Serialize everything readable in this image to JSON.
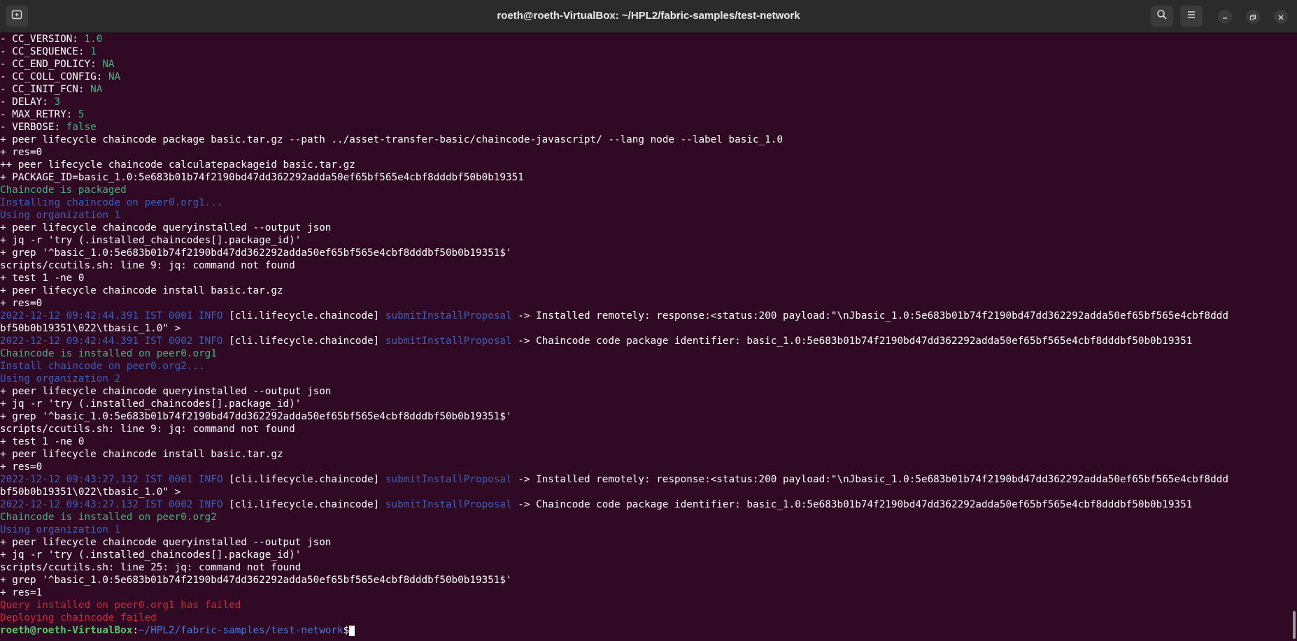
{
  "window": {
    "title": "roeth@roeth-VirtualBox: ~/HPL2/fabric-samples/test-network",
    "new_tab_icon": "new-tab-icon",
    "search_icon": "search-icon",
    "menu_icon": "hamburger-menu-icon"
  },
  "colors": {
    "background": "#300a24",
    "green": "#4bb07f",
    "blue": "#3f5fb8",
    "red": "#d0283a"
  },
  "terminal": {
    "lines": [
      {
        "segs": [
          {
            "t": "- CC_VERSION: ",
            "c": ""
          },
          {
            "t": "1.0",
            "c": "g"
          }
        ]
      },
      {
        "segs": [
          {
            "t": "- CC_SEQUENCE: ",
            "c": ""
          },
          {
            "t": "1",
            "c": "g"
          }
        ]
      },
      {
        "segs": [
          {
            "t": "- CC_END_POLICY: ",
            "c": ""
          },
          {
            "t": "NA",
            "c": "g"
          }
        ]
      },
      {
        "segs": [
          {
            "t": "- CC_COLL_CONFIG: ",
            "c": ""
          },
          {
            "t": "NA",
            "c": "g"
          }
        ]
      },
      {
        "segs": [
          {
            "t": "- CC_INIT_FCN: ",
            "c": ""
          },
          {
            "t": "NA",
            "c": "g"
          }
        ]
      },
      {
        "segs": [
          {
            "t": "- DELAY: ",
            "c": ""
          },
          {
            "t": "3",
            "c": "g"
          }
        ]
      },
      {
        "segs": [
          {
            "t": "- MAX_RETRY: ",
            "c": ""
          },
          {
            "t": "5",
            "c": "g"
          }
        ]
      },
      {
        "segs": [
          {
            "t": "- VERBOSE: ",
            "c": ""
          },
          {
            "t": "false",
            "c": "g"
          }
        ]
      },
      {
        "segs": [
          {
            "t": "+ peer lifecycle chaincode package basic.tar.gz --path ../asset-transfer-basic/chaincode-javascript/ --lang node --label basic_1.0",
            "c": ""
          }
        ]
      },
      {
        "segs": [
          {
            "t": "+ res=0",
            "c": ""
          }
        ]
      },
      {
        "segs": [
          {
            "t": "++ peer lifecycle chaincode calculatepackageid basic.tar.gz",
            "c": ""
          }
        ]
      },
      {
        "segs": [
          {
            "t": "+ PACKAGE_ID=basic_1.0:5e683b01b74f2190bd47dd362292adda50ef65bf565e4cbf8dddbf50b0b19351",
            "c": ""
          }
        ]
      },
      {
        "segs": [
          {
            "t": "Chaincode is packaged",
            "c": "g"
          }
        ]
      },
      {
        "segs": [
          {
            "t": "Installing chaincode on peer0.org1...",
            "c": "b"
          }
        ]
      },
      {
        "segs": [
          {
            "t": "Using organization 1",
            "c": "b"
          }
        ]
      },
      {
        "segs": [
          {
            "t": "+ peer lifecycle chaincode queryinstalled --output json",
            "c": ""
          }
        ]
      },
      {
        "segs": [
          {
            "t": "+ jq -r 'try (.installed_chaincodes[].package_id)'",
            "c": ""
          }
        ]
      },
      {
        "segs": [
          {
            "t": "+ grep '^basic_1.0:5e683b01b74f2190bd47dd362292adda50ef65bf565e4cbf8dddbf50b0b19351$'",
            "c": ""
          }
        ]
      },
      {
        "segs": [
          {
            "t": "scripts/ccutils.sh: line 9: jq: command not found",
            "c": ""
          }
        ]
      },
      {
        "segs": [
          {
            "t": "+ test 1 -ne 0",
            "c": ""
          }
        ]
      },
      {
        "segs": [
          {
            "t": "+ peer lifecycle chaincode install basic.tar.gz",
            "c": ""
          }
        ]
      },
      {
        "segs": [
          {
            "t": "+ res=0",
            "c": ""
          }
        ]
      },
      {
        "segs": [
          {
            "t": "2022-12-12 09:42:44.391 IST 0001 INFO",
            "c": "b"
          },
          {
            "t": " [cli.lifecycle.chaincode] ",
            "c": ""
          },
          {
            "t": "submitInstallProposal",
            "c": "b"
          },
          {
            "t": " -> Installed remotely: response:<status:200 payload:\"\\nJbasic_1.0:5e683b01b74f2190bd47dd362292adda50ef65bf565e4cbf8ddd",
            "c": ""
          }
        ]
      },
      {
        "segs": [
          {
            "t": "bf50b0b19351\\022\\tbasic_1.0\" >",
            "c": ""
          }
        ]
      },
      {
        "segs": [
          {
            "t": "2022-12-12 09:42:44.391 IST 0002 INFO",
            "c": "b"
          },
          {
            "t": " [cli.lifecycle.chaincode] ",
            "c": ""
          },
          {
            "t": "submitInstallProposal",
            "c": "b"
          },
          {
            "t": " -> Chaincode code package identifier: basic_1.0:5e683b01b74f2190bd47dd362292adda50ef65bf565e4cbf8dddbf50b0b19351",
            "c": ""
          }
        ]
      },
      {
        "segs": [
          {
            "t": "Chaincode is installed on peer0.org1",
            "c": "g"
          }
        ]
      },
      {
        "segs": [
          {
            "t": "Install chaincode on peer0.org2...",
            "c": "b"
          }
        ]
      },
      {
        "segs": [
          {
            "t": "Using organization 2",
            "c": "b"
          }
        ]
      },
      {
        "segs": [
          {
            "t": "+ peer lifecycle chaincode queryinstalled --output json",
            "c": ""
          }
        ]
      },
      {
        "segs": [
          {
            "t": "+ jq -r 'try (.installed_chaincodes[].package_id)'",
            "c": ""
          }
        ]
      },
      {
        "segs": [
          {
            "t": "+ grep '^basic_1.0:5e683b01b74f2190bd47dd362292adda50ef65bf565e4cbf8dddbf50b0b19351$'",
            "c": ""
          }
        ]
      },
      {
        "segs": [
          {
            "t": "scripts/ccutils.sh: line 9: jq: command not found",
            "c": ""
          }
        ]
      },
      {
        "segs": [
          {
            "t": "+ test 1 -ne 0",
            "c": ""
          }
        ]
      },
      {
        "segs": [
          {
            "t": "+ peer lifecycle chaincode install basic.tar.gz",
            "c": ""
          }
        ]
      },
      {
        "segs": [
          {
            "t": "+ res=0",
            "c": ""
          }
        ]
      },
      {
        "segs": [
          {
            "t": "2022-12-12 09:43:27.132 IST 0001 INFO",
            "c": "b"
          },
          {
            "t": " [cli.lifecycle.chaincode] ",
            "c": ""
          },
          {
            "t": "submitInstallProposal",
            "c": "b"
          },
          {
            "t": " -> Installed remotely: response:<status:200 payload:\"\\nJbasic_1.0:5e683b01b74f2190bd47dd362292adda50ef65bf565e4cbf8ddd",
            "c": ""
          }
        ]
      },
      {
        "segs": [
          {
            "t": "bf50b0b19351\\022\\tbasic_1.0\" >",
            "c": ""
          }
        ]
      },
      {
        "segs": [
          {
            "t": "2022-12-12 09:43:27.132 IST 0002 INFO",
            "c": "b"
          },
          {
            "t": " [cli.lifecycle.chaincode] ",
            "c": ""
          },
          {
            "t": "submitInstallProposal",
            "c": "b"
          },
          {
            "t": " -> Chaincode code package identifier: basic_1.0:5e683b01b74f2190bd47dd362292adda50ef65bf565e4cbf8dddbf50b0b19351",
            "c": ""
          }
        ]
      },
      {
        "segs": [
          {
            "t": "Chaincode is installed on peer0.org2",
            "c": "g"
          }
        ]
      },
      {
        "segs": [
          {
            "t": "Using organization 1",
            "c": "b"
          }
        ]
      },
      {
        "segs": [
          {
            "t": "+ peer lifecycle chaincode queryinstalled --output json",
            "c": ""
          }
        ]
      },
      {
        "segs": [
          {
            "t": "+ jq -r 'try (.installed_chaincodes[].package_id)'",
            "c": ""
          }
        ]
      },
      {
        "segs": [
          {
            "t": "scripts/ccutils.sh: line 25: jq: command not found",
            "c": ""
          }
        ]
      },
      {
        "segs": [
          {
            "t": "+ grep '^basic_1.0:5e683b01b74f2190bd47dd362292adda50ef65bf565e4cbf8dddbf50b0b19351$'",
            "c": ""
          }
        ]
      },
      {
        "segs": [
          {
            "t": "+ res=1",
            "c": ""
          }
        ]
      },
      {
        "segs": [
          {
            "t": "Query installed on peer0.org1 has failed",
            "c": "r"
          }
        ]
      },
      {
        "segs": [
          {
            "t": "Deploying chaincode failed",
            "c": "r"
          }
        ]
      }
    ],
    "prompt": {
      "user_host": "roeth@roeth-VirtualBox",
      "separator": ":",
      "path": "~/HPL2/fabric-samples/test-network",
      "symbol": "$"
    }
  }
}
